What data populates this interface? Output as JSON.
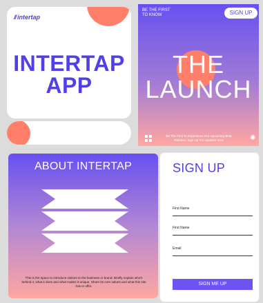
{
  "brand": {
    "logo_mark": "//",
    "logo_text": "intertap",
    "app_title_line1": "INTERTAP",
    "app_title_line2": "APP"
  },
  "launch": {
    "eyebrow": "BE THE FIRST\nTO KNOW",
    "signup_label": "SIGN UP",
    "title_line1": "THE",
    "title_line2": "LAUNCH",
    "copy": "Be The First To Experience Our Upcoming Beta Release, Sign Up For Updates Now"
  },
  "about": {
    "title": "ABOUT INTERTAP",
    "copy": "This is the space to introduce visitors to the business or brand. Briefly explain who's behind it, what it does and what makes it unique. Share its core values and what this site has to offer."
  },
  "signup": {
    "title": "SIGN UP",
    "fields": [
      {
        "label": "First Name"
      },
      {
        "label": "First Name"
      },
      {
        "label": "Email"
      }
    ],
    "button_label": "SIGN ME UP"
  },
  "colors": {
    "accent": "#5140e6",
    "coral": "#ff7f6b",
    "gradient_top": "#6750f0",
    "gradient_bottom": "#ffa7a0"
  },
  "icons": {
    "grid": "grid-icon",
    "spinner": "loading-icon"
  }
}
